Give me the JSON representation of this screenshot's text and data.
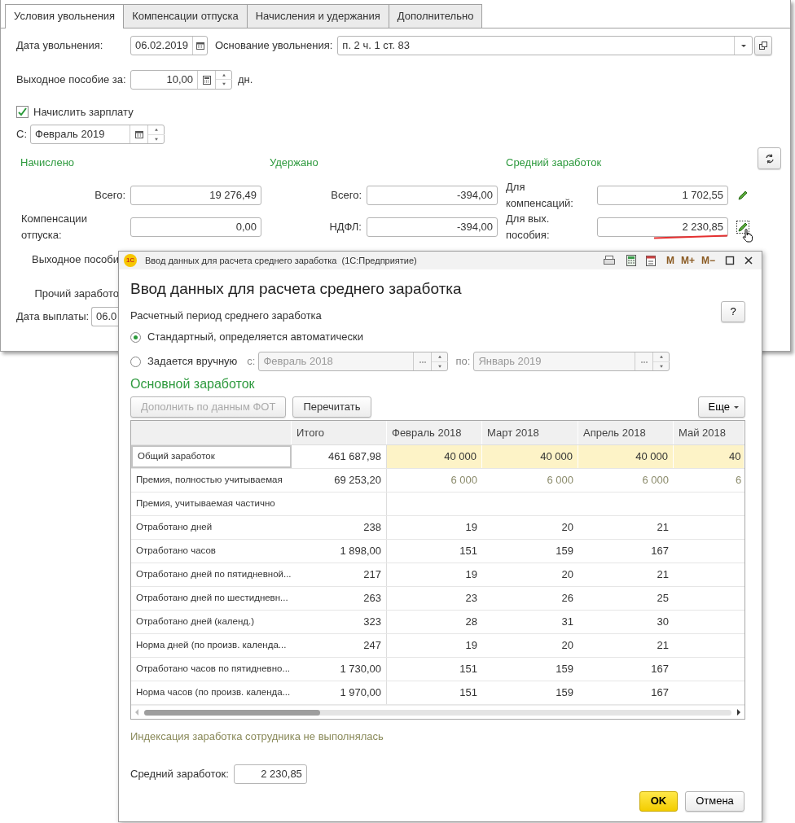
{
  "main_form": {
    "tabs": [
      {
        "label": "Условия увольнения",
        "selected": true
      },
      {
        "label": "Компенсации отпуска",
        "selected": false
      },
      {
        "label": "Начисления и удержания",
        "selected": false
      },
      {
        "label": "Дополнительно",
        "selected": false
      }
    ],
    "dismissal_date": {
      "label": "Дата увольнения:",
      "value": "06.02.2019"
    },
    "dismissal_reason": {
      "label": "Основание увольнения:",
      "value": "п. 2 ч. 1 ст. 83"
    },
    "severance": {
      "label": "Выходное пособие за:",
      "value": "10,00",
      "unit": "дн."
    },
    "accrue_salary": {
      "label": "Начислить зарплату",
      "checked": true
    },
    "from": {
      "label": "С:",
      "value": "Февраль 2019"
    },
    "sections": [
      {
        "title": "Начислено",
        "rows": [
          {
            "label": "Всего:",
            "value": "19 276,49"
          },
          {
            "label": "Компенсации отпуска:",
            "value": "0,00"
          },
          {
            "label": "Выходное пособи"
          },
          {
            "label": "Прочий заработо"
          }
        ]
      },
      {
        "title": "Удержано",
        "rows": [
          {
            "label": "Всего:",
            "value": "-394,00"
          },
          {
            "label": "НДФЛ:",
            "value": "-394,00"
          }
        ]
      },
      {
        "title": "Средний заработок",
        "rows": [
          {
            "label": "Для компенсаций:",
            "value": "1 702,55",
            "underlined": false,
            "focused": false
          },
          {
            "label": "Для вых. пособия:",
            "value": "2 230,85",
            "underlined": true,
            "focused": true
          }
        ]
      }
    ],
    "payment_date": {
      "label": "Дата выплаты:",
      "value": "06.0"
    }
  },
  "dialog": {
    "logo": "1С",
    "title": "Ввод данных для расчета среднего заработка  (1С:Предприятие)",
    "title_buttons": [
      "M",
      "M+",
      "M−"
    ],
    "heading": "Ввод данных для расчета среднего заработка",
    "period_label": "Расчетный период среднего заработка",
    "help": "?",
    "period_options": [
      {
        "label": "Стандартный, определяется автоматически",
        "selected": true
      },
      {
        "label": "Задается вручную",
        "selected": false,
        "from_label": "с:",
        "from": "Февраль 2018",
        "to_label": "по:",
        "to": "Январь 2019"
      }
    ],
    "section_title": "Основной заработок",
    "buttons": [
      {
        "label": "Дополнить по данным ФОТ",
        "disabled": true
      },
      {
        "label": "Перечитать",
        "disabled": false
      }
    ],
    "more": "Еще",
    "table": {
      "columns": [
        "Итого",
        "Февраль 2018",
        "Март 2018",
        "Апрель 2018",
        "Май 2018"
      ],
      "rows": [
        {
          "label": "Общий заработок",
          "kind": "amount",
          "selected": true,
          "total": "461 687,98",
          "months": [
            "40 000",
            "40 000",
            "40 000",
            "40"
          ]
        },
        {
          "label": "Премия, полностью учитываемая",
          "kind": "bonus",
          "selected": false,
          "total": "69 253,20",
          "months": [
            "6 000",
            "6 000",
            "6 000",
            "6"
          ]
        },
        {
          "label": "Премия, учитываемая частично",
          "kind": "bonus",
          "selected": false,
          "months": []
        },
        {
          "label": "Отработано дней",
          "kind": "count",
          "selected": false,
          "total": "238",
          "months": [
            "19",
            "20",
            "21"
          ]
        },
        {
          "label": "Отработано часов",
          "kind": "count",
          "selected": false,
          "total": "1 898,00",
          "months": [
            "151",
            "159",
            "167"
          ]
        },
        {
          "label": "Отработано дней по пятидневной...",
          "kind": "count",
          "selected": false,
          "total": "217",
          "months": [
            "19",
            "20",
            "21"
          ]
        },
        {
          "label": "Отработано дней по шестидневн...",
          "kind": "count",
          "selected": false,
          "total": "263",
          "months": [
            "23",
            "26",
            "25"
          ]
        },
        {
          "label": "Отработано дней (календ.)",
          "kind": "count",
          "selected": false,
          "total": "323",
          "months": [
            "28",
            "31",
            "30"
          ]
        },
        {
          "label": "Норма дней (по произв. календа...",
          "kind": "count",
          "selected": false,
          "total": "247",
          "months": [
            "19",
            "20",
            "21"
          ]
        },
        {
          "label": "Отработано часов по пятидневно...",
          "kind": "count",
          "selected": false,
          "total": "1 730,00",
          "months": [
            "151",
            "159",
            "167"
          ]
        },
        {
          "label": "Норма часов (по произв. календа...",
          "kind": "count",
          "selected": false,
          "total": "1 970,00",
          "months": [
            "151",
            "159",
            "167"
          ]
        }
      ]
    },
    "indexation_note": "Индексация заработка сотрудника не выполнялась",
    "average": {
      "label": "Средний заработок:",
      "value": "2 230,85"
    },
    "ok": "OK",
    "cancel": "Отмена"
  }
}
